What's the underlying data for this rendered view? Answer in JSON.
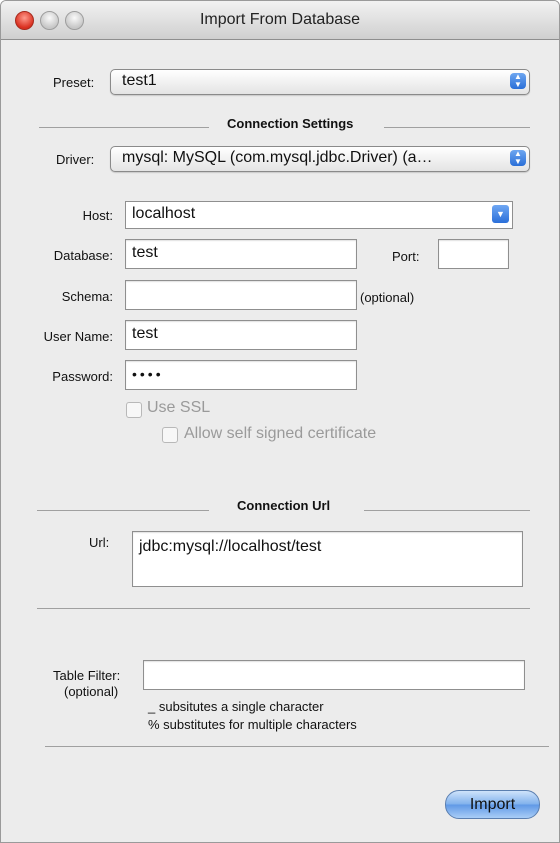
{
  "window": {
    "title": "Import From Database"
  },
  "preset": {
    "label": "Preset:",
    "value": "test1"
  },
  "connection_settings": {
    "title": "Connection Settings",
    "driver_label": "Driver:",
    "driver_value": "mysql: MySQL (com.mysql.jdbc.Driver)  (a…",
    "host_label": "Host:",
    "host_value": "localhost",
    "database_label": "Database:",
    "database_value": "test",
    "port_label": "Port:",
    "port_value": "",
    "schema_label": "Schema:",
    "schema_value": "",
    "schema_hint": "(optional)",
    "username_label": "User Name:",
    "username_value": "test",
    "password_label": "Password:",
    "password_value": "••••",
    "use_ssl_label": "Use SSL",
    "allow_self_signed_label": "Allow self signed certificate"
  },
  "connection_url": {
    "title": "Connection Url",
    "url_label": "Url:",
    "url_value": "jdbc:mysql://localhost/test"
  },
  "table_filter": {
    "label": "Table Filter:",
    "optional": "(optional)",
    "value": "",
    "hint_single": "_ subsitutes a single character",
    "hint_multiple": "% substitutes for multiple characters"
  },
  "actions": {
    "import_label": "Import"
  },
  "colors": {
    "accent": "#2a6fd8"
  }
}
